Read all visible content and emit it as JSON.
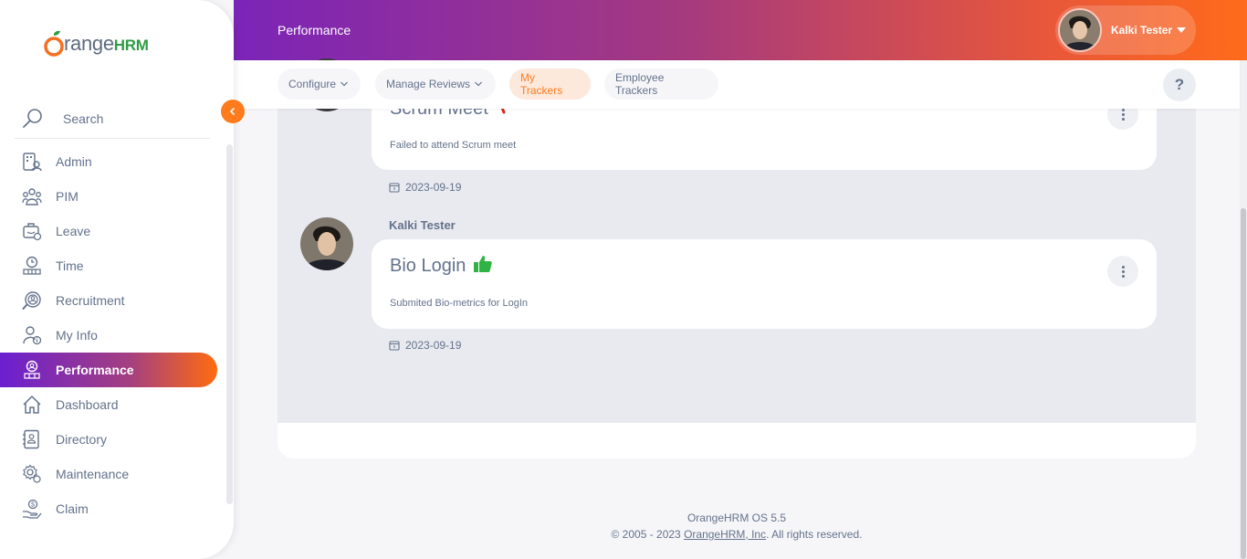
{
  "brand": {
    "o": "O",
    "range": "range",
    "hrm": "HRM"
  },
  "sidebar": {
    "search_label": "Search",
    "items": [
      {
        "label": "Admin",
        "icon": "admin-icon"
      },
      {
        "label": "PIM",
        "icon": "pim-icon"
      },
      {
        "label": "Leave",
        "icon": "leave-icon"
      },
      {
        "label": "Time",
        "icon": "time-icon"
      },
      {
        "label": "Recruitment",
        "icon": "recruitment-icon"
      },
      {
        "label": "My Info",
        "icon": "my-info-icon"
      },
      {
        "label": "Performance",
        "icon": "performance-icon",
        "active": true
      },
      {
        "label": "Dashboard",
        "icon": "dashboard-icon"
      },
      {
        "label": "Directory",
        "icon": "directory-icon"
      },
      {
        "label": "Maintenance",
        "icon": "maintenance-icon"
      },
      {
        "label": "Claim",
        "icon": "claim-icon"
      }
    ]
  },
  "header": {
    "title": "Performance",
    "user_name": "Kalki Tester"
  },
  "subnav": {
    "configure": "Configure",
    "manage_reviews": "Manage Reviews",
    "my_trackers": "My Trackers",
    "employee_trackers": "Employee Trackers",
    "help": "?"
  },
  "entries": [
    {
      "title": "Scrum Meet",
      "description": "Failed to attend Scrum meet",
      "date": "2023-09-19",
      "sentiment": "negative"
    },
    {
      "author": "Kalki Tester",
      "title": "Bio Login",
      "description": "Submited Bio-metrics for LogIn",
      "date": "2023-09-19",
      "sentiment": "positive"
    }
  ],
  "footer": {
    "version": "OrangeHRM OS 5.5",
    "copyright_prefix": "© 2005 - 2023 ",
    "link_text": "OrangeHRM, Inc",
    "copyright_suffix": ". All rights reserved."
  },
  "colors": {
    "accent": "#ff7b1d",
    "text": "#64728c",
    "positive": "#2fb344",
    "negative": "#e02020"
  }
}
